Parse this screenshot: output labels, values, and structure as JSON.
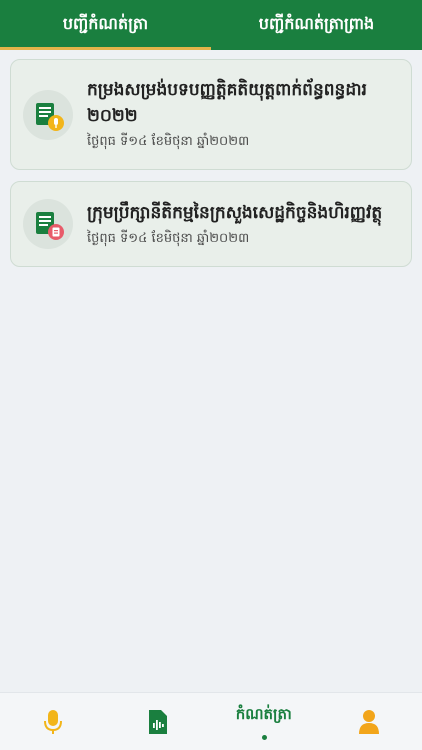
{
  "tabs": [
    {
      "label": "បញ្ជីកំណត់ត្រា",
      "active": true
    },
    {
      "label": "បញ្ជីកំណត់ត្រាព្រាង",
      "active": false
    }
  ],
  "records": [
    {
      "title": "កម្រងសម្រង់បទបញ្ញត្តិគតិយុត្តពាក់ព័ន្ធពន្ធដារ ២០២២",
      "date": "ថ្ងៃពុធ ទី១៤ ខែមិថុនា ឆ្នាំ២០២៣",
      "icon": "audio-document-icon"
    },
    {
      "title": "ក្រុមប្រឹក្សានីតិកម្មនៃក្រសួងសេដ្ឋកិច្ចនិងហិរញ្ញវត្ថុ",
      "date": "ថ្ងៃពុធ ទី១៤ ខែមិថុនា ឆ្នាំ២០២៣",
      "icon": "file-document-icon"
    }
  ],
  "bottom_nav": {
    "mic_icon": "microphone-icon",
    "file_icon": "audio-file-icon",
    "records_label": "កំណត់ត្រា",
    "profile_icon": "user-icon"
  },
  "colors": {
    "primary": "#1a7f3f",
    "accent": "#e3b44a",
    "mic": "#f2b51a",
    "profile": "#f2a51a"
  }
}
